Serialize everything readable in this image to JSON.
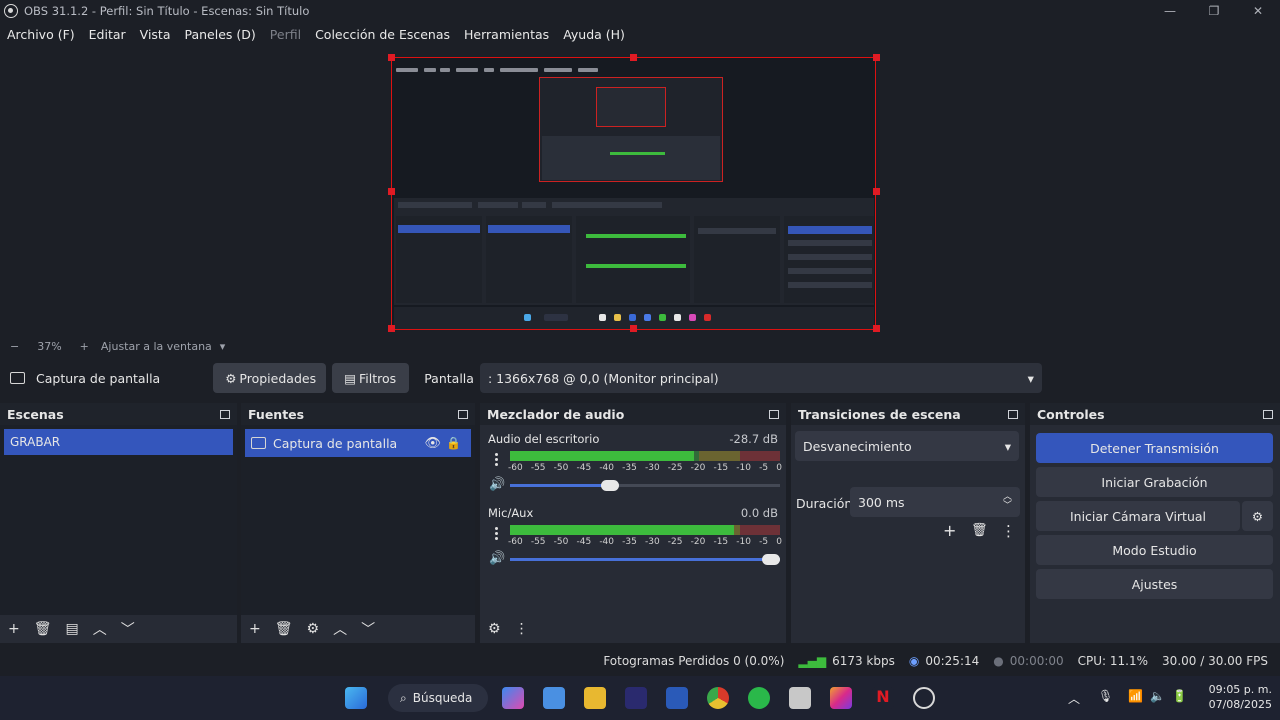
{
  "window": {
    "title": "OBS 31.1.2 - Perfil: Sin Título - Escenas: Sin Título"
  },
  "menu": [
    "Archivo (F)",
    "Editar",
    "Vista",
    "Paneles (D)",
    "Perfil",
    "Colección de Escenas",
    "Herramientas",
    "Ayuda (H)"
  ],
  "zoom": {
    "minus": "−",
    "value": "37%",
    "plus": "+",
    "fit_label": "Ajustar a la ventana"
  },
  "source_toolbar": {
    "source_name": "Captura de pantalla",
    "properties_label": "Propiedades",
    "filters_label": "Filtros",
    "display_label": "Pantalla",
    "display_value": ": 1366x768 @ 0,0 (Monitor principal)"
  },
  "scenes": {
    "title": "Escenas",
    "items": [
      "GRABAR"
    ]
  },
  "sources": {
    "title": "Fuentes",
    "items": [
      "Captura de pantalla"
    ]
  },
  "mixer": {
    "title": "Mezclador de audio",
    "ticks": [
      "-60",
      "-55",
      "-50",
      "-45",
      "-40",
      "-35",
      "-30",
      "-25",
      "-20",
      "-15",
      "-10",
      "-5",
      "0"
    ],
    "channels": [
      {
        "name": "Audio del escritorio",
        "db": "-28.7 dB",
        "volume": 0.37,
        "level": 0.68
      },
      {
        "name": "Mic/Aux",
        "db": "0.0 dB",
        "volume": 1.0,
        "level": 0.83
      }
    ]
  },
  "transitions": {
    "title": "Transiciones de escena",
    "selected": "Desvanecimiento",
    "duration_label": "Duración",
    "duration_value": "300 ms"
  },
  "controls": {
    "title": "Controles",
    "stop_stream": "Detener Transmisión",
    "start_recording": "Iniciar Grabación",
    "start_virtual_cam": "Iniciar Cámara Virtual",
    "studio_mode": "Modo Estudio",
    "settings": "Ajustes"
  },
  "status": {
    "dropped_frames": "Fotogramas Perdidos 0 (0.0%)",
    "bitrate": "6173 kbps",
    "stream_time": "00:25:14",
    "record_time": "00:00:00",
    "cpu": "CPU: 11.1%",
    "fps": "30.00 / 30.00 FPS"
  },
  "taskbar": {
    "search_label": "Búsqueda",
    "time": "09:05 p. m.",
    "date": "07/08/2025"
  },
  "colors": {
    "accent": "#3456bc",
    "preview_border": "#e01b24",
    "meter_green": "#3dbb3d",
    "meter_yellow": "#bcaa2a",
    "meter_red": "#c43a3a"
  }
}
